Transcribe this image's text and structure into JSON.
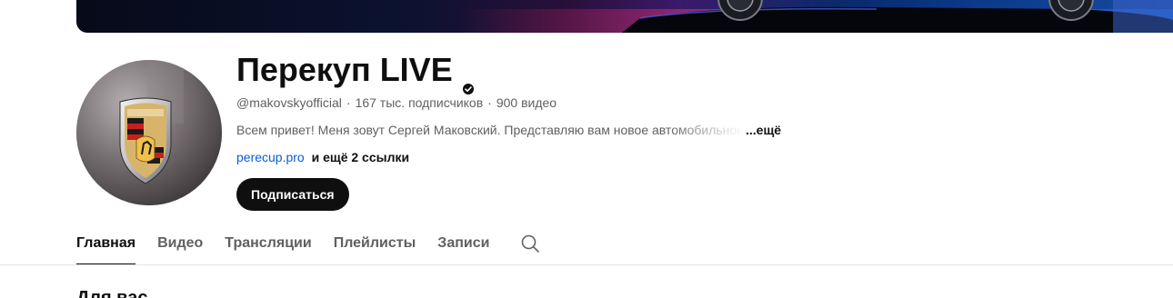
{
  "channel": {
    "name": "Перекуп LIVE",
    "handle": "@makovskyofficial",
    "subscribers": "167 тыс. подписчиков",
    "videos": "900 видео",
    "description": "Всем привет! Меня зовут Сергей Маковский. Представляю вам новое автомобильное",
    "description_more": "...ещё",
    "link": "perecup.pro",
    "more_links": "и ещё 2 ссылки",
    "subscribe_label": "Подписаться",
    "meta_separator": "·"
  },
  "tabs": [
    {
      "label": "Главная",
      "active": true
    },
    {
      "label": "Видео",
      "active": false
    },
    {
      "label": "Трансляции",
      "active": false
    },
    {
      "label": "Плейлисты",
      "active": false
    },
    {
      "label": "Записи",
      "active": false
    }
  ],
  "section": {
    "title": "Для вас"
  },
  "icons": {
    "verified": "verified-check-icon",
    "search": "search-icon",
    "avatar_logo": "porsche-crest-logo"
  },
  "colors": {
    "primary_text": "#0f0f0f",
    "secondary_text": "#606060",
    "link": "#065fd4",
    "button_bg": "#0f0f0f",
    "divider": "#e5e5e5"
  }
}
